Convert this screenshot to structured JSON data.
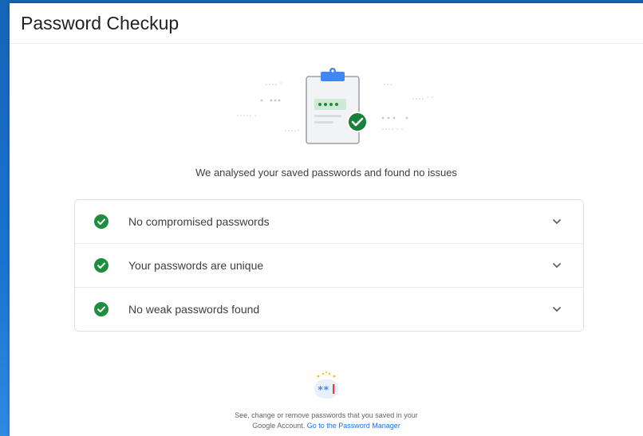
{
  "window": {
    "title": "Password Checkup"
  },
  "summary": {
    "text": "We analysed your saved passwords and found no issues"
  },
  "results": [
    {
      "label": "No compromised passwords",
      "status": "ok"
    },
    {
      "label": "Your passwords are unique",
      "status": "ok"
    },
    {
      "label": "No weak passwords found",
      "status": "ok"
    }
  ],
  "password_manager": {
    "description": "See, change or remove passwords that you saved in your Google Account.",
    "link_text": "Go to the Password Manager"
  },
  "icons": {
    "result_status": "check-circle-icon",
    "expand": "chevron-down-icon",
    "illustration": "clipboard-check-illustration",
    "password_manager": "password-manager-icon"
  },
  "colors": {
    "success_green": "#1e8e3e",
    "link_blue": "#1a73e8",
    "desktop_blue": "#1a6fc4"
  }
}
